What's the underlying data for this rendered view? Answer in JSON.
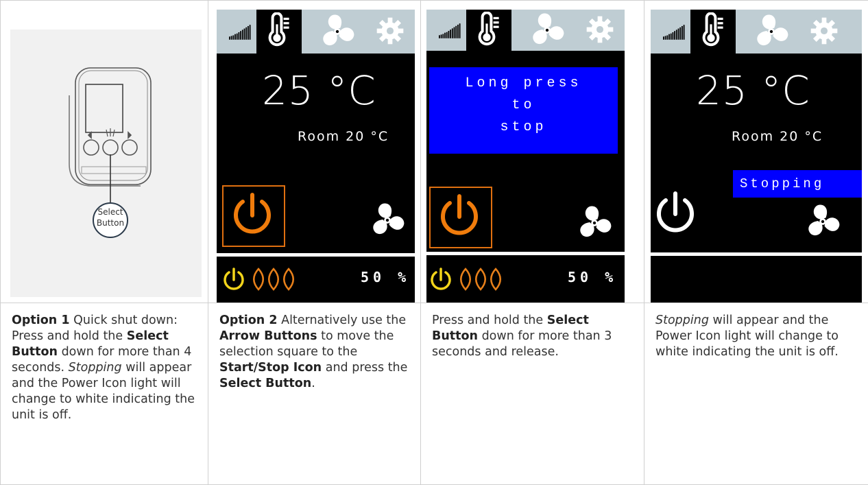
{
  "device": {
    "callout_line1": "Select",
    "callout_line2": "Button"
  },
  "screens": {
    "one": {
      "temp": "25 °C",
      "room": "Room  20 °C",
      "percent": "50 %"
    },
    "two": {
      "msg_line1": "Long press",
      "msg_line2": "to",
      "msg_line3": "stop",
      "percent": "50 %"
    },
    "three": {
      "temp": "25 °C",
      "room": "Room  20 °C",
      "status": "Stopping"
    }
  },
  "captions": {
    "c1": {
      "option": "Option 1",
      "t1": " Quick shut down: Press and hold the ",
      "b1": "Select Button",
      "t2": " down for more than 4 seconds. ",
      "i1": "Stopping",
      "t3": " will appear and the Power Icon light will change to white indicating the unit is off."
    },
    "c2": {
      "option": "Option 2",
      "t1": " Alternatively use the ",
      "b1": "Arrow Buttons",
      "t2": " to move the selection square to the ",
      "b2": "Start/Stop Icon",
      "t3": " and press the ",
      "b3": "Select Button",
      "t4": "."
    },
    "c3": {
      "t1": "Press and hold the ",
      "b1": "Select Button",
      "t2": " down for more than 3 seconds and release."
    },
    "c4": {
      "i1": "Stopping",
      "t1": " will appear and the Power Icon light will change to white indicating the unit is off."
    }
  },
  "colors": {
    "tab_bg": "#bfcdd3",
    "power_orange": "#f07c0c",
    "power_yellow": "#f2d41a",
    "flame_orange": "#e8801a",
    "message_blue": "#0000ff"
  },
  "icons": [
    "signal-bars-icon",
    "thermometer-icon",
    "fan-icon",
    "gear-icon",
    "power-icon",
    "flame-icon"
  ]
}
